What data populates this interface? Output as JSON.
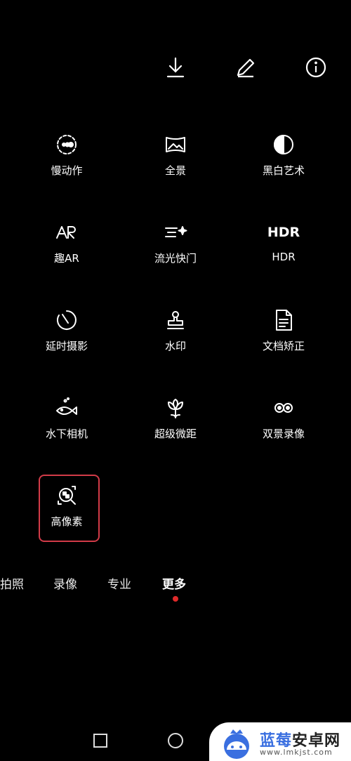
{
  "top_bar": {
    "icons": [
      "download-icon",
      "edit-icon",
      "info-icon"
    ]
  },
  "modes": [
    {
      "label": "慢动作",
      "icon": "slow-motion-icon"
    },
    {
      "label": "全景",
      "icon": "panorama-icon"
    },
    {
      "label": "黑白艺术",
      "icon": "monochrome-icon"
    },
    {
      "label": "趣AR",
      "icon": "ar-icon"
    },
    {
      "label": "流光快门",
      "icon": "light-painting-icon"
    },
    {
      "label": "HDR",
      "icon": "hdr-icon",
      "icon_text": "HDR"
    },
    {
      "label": "延时摄影",
      "icon": "timelapse-icon"
    },
    {
      "label": "水印",
      "icon": "watermark-stamp-icon"
    },
    {
      "label": "文档矫正",
      "icon": "document-icon"
    },
    {
      "label": "水下相机",
      "icon": "underwater-fish-icon"
    },
    {
      "label": "超级微距",
      "icon": "macro-flower-icon"
    },
    {
      "label": "双景录像",
      "icon": "dual-view-icon"
    },
    {
      "label": "高像素",
      "icon": "high-resolution-icon",
      "selected": true
    }
  ],
  "camera_tabs": [
    {
      "label": "拍照"
    },
    {
      "label": "录像"
    },
    {
      "label": "专业"
    },
    {
      "label": "更多",
      "active": true
    }
  ],
  "nav": {
    "icons": [
      "recent-apps-icon",
      "home-icon"
    ]
  },
  "watermark": {
    "title": "蓝莓安卓网",
    "url": "www.lmkjst.com"
  },
  "colors": {
    "selection": "#d23b48",
    "active_dot": "#e02a2a",
    "watermark_blue": "#3a6fe0"
  }
}
